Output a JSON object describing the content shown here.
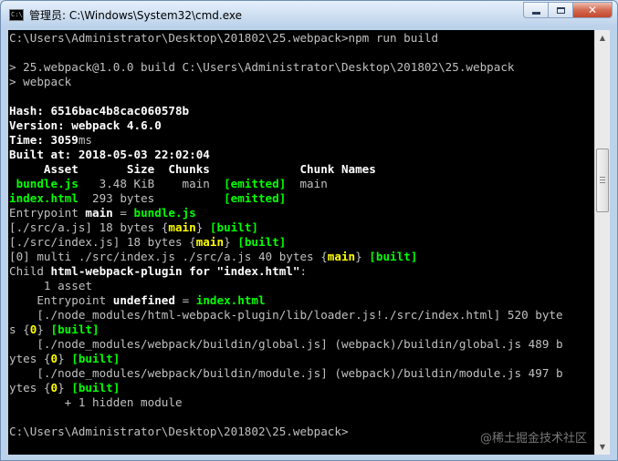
{
  "window": {
    "title": "管理员: C:\\Windows\\System32\\cmd.exe",
    "icon_text": "C:\\",
    "buttons": {
      "minimize_icon": "minimize-icon",
      "maximize_icon": "maximize-icon",
      "close_icon": "close-icon",
      "close_glyph": "✕"
    }
  },
  "colors": {
    "console_background": "#000000",
    "default_text": "#c0c0c0",
    "highlight_green": "#00ff00",
    "highlight_yellow": "#ffff00",
    "bright_white": "#ffffff"
  },
  "console": {
    "lines": [
      [
        {
          "t": "C:\\Users\\Administrator\\Desktop\\201802\\25.webpack>npm run build"
        }
      ],
      [
        {
          "t": ""
        }
      ],
      [
        {
          "t": "> 25.webpack@1.0.0 build C:\\Users\\Administrator\\Desktop\\201802\\25.webpack"
        }
      ],
      [
        {
          "t": "> webpack"
        }
      ],
      [
        {
          "t": ""
        }
      ],
      [
        {
          "t": "Hash: ",
          "c": "w b"
        },
        {
          "t": "6516bac4b8cac060578b",
          "c": "w b"
        }
      ],
      [
        {
          "t": "Version: webpack ",
          "c": "w b"
        },
        {
          "t": "4.6.0",
          "c": "w b"
        }
      ],
      [
        {
          "t": "Time: ",
          "c": "w b"
        },
        {
          "t": "3059",
          "c": "w b"
        },
        {
          "t": "ms"
        }
      ],
      [
        {
          "t": "Built at: 2018-05-03 ",
          "c": "w b"
        },
        {
          "t": "22:02:04",
          "c": "w b"
        }
      ],
      [
        {
          "t": "     Asset       Size  Chunks             Chunk Names",
          "c": "w b"
        }
      ],
      [
        {
          "t": " bundle.js",
          "c": "g b"
        },
        {
          "t": "   3.48 KiB    main  "
        },
        {
          "t": "[emitted]",
          "c": "g b"
        },
        {
          "t": "  main"
        }
      ],
      [
        {
          "t": "index.html",
          "c": "g b"
        },
        {
          "t": "  293 bytes          "
        },
        {
          "t": "[emitted]",
          "c": "g b"
        }
      ],
      [
        {
          "t": "Entrypoint "
        },
        {
          "t": "main",
          "c": "w b"
        },
        {
          "t": " = "
        },
        {
          "t": "bundle.js",
          "c": "g b"
        }
      ],
      [
        {
          "t": "[./src/a.js] 18 bytes {"
        },
        {
          "t": "main",
          "c": "y b"
        },
        {
          "t": "} "
        },
        {
          "t": "[built]",
          "c": "g b"
        }
      ],
      [
        {
          "t": "[./src/index.js] 18 bytes {"
        },
        {
          "t": "main",
          "c": "y b"
        },
        {
          "t": "} "
        },
        {
          "t": "[built]",
          "c": "g b"
        }
      ],
      [
        {
          "t": "[0] multi ./src/index.js ./src/a.js 40 bytes {"
        },
        {
          "t": "main",
          "c": "y b"
        },
        {
          "t": "} "
        },
        {
          "t": "[built]",
          "c": "g b"
        }
      ],
      [
        {
          "t": "Child "
        },
        {
          "t": "html-webpack-plugin for \"index.html\"",
          "c": "w b"
        },
        {
          "t": ":"
        }
      ],
      [
        {
          "t": "     1 asset"
        }
      ],
      [
        {
          "t": "    Entrypoint "
        },
        {
          "t": "undefined",
          "c": "w b"
        },
        {
          "t": " = "
        },
        {
          "t": "index.html",
          "c": "g b"
        }
      ],
      [
        {
          "t": "    [./node_modules/html-webpack-plugin/lib/loader.js!./src/index.html] 520 byte"
        }
      ],
      [
        {
          "t": "s {"
        },
        {
          "t": "0",
          "c": "y b"
        },
        {
          "t": "} "
        },
        {
          "t": "[built]",
          "c": "g b"
        }
      ],
      [
        {
          "t": "    [./node_modules/webpack/buildin/global.js] (webpack)/buildin/global.js 489 b"
        }
      ],
      [
        {
          "t": "ytes {"
        },
        {
          "t": "0",
          "c": "y b"
        },
        {
          "t": "} "
        },
        {
          "t": "[built]",
          "c": "g b"
        }
      ],
      [
        {
          "t": "    [./node_modules/webpack/buildin/module.js] (webpack)/buildin/module.js 497 b"
        }
      ],
      [
        {
          "t": "ytes {"
        },
        {
          "t": "0",
          "c": "y b"
        },
        {
          "t": "} "
        },
        {
          "t": "[built]",
          "c": "g b"
        }
      ],
      [
        {
          "t": "        + 1 hidden module"
        }
      ],
      [
        {
          "t": ""
        }
      ],
      [
        {
          "t": "C:\\Users\\Administrator\\Desktop\\201802\\25.webpack>"
        }
      ]
    ]
  },
  "watermark": "@稀土掘金技术社区",
  "scrollbar": {
    "up_icon": "scroll-up-arrow-icon",
    "down_icon": "scroll-down-arrow-icon",
    "up_glyph": "▲",
    "down_glyph": "▼"
  }
}
